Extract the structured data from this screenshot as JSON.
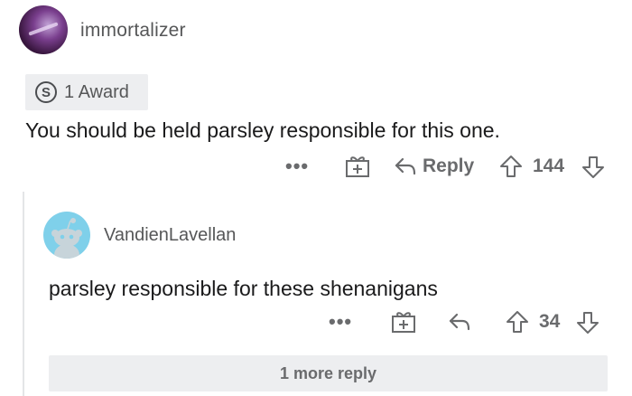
{
  "comment": {
    "author": "immortalizer",
    "award_label": "1 Award",
    "body": "You should be held parsley responsible for this one.",
    "actions": {
      "more": "•••",
      "reply": "Reply",
      "score": "144"
    }
  },
  "reply": {
    "author": "VandienLavellan",
    "body": "parsley responsible for these shenanigans",
    "actions": {
      "more": "•••",
      "score": "34"
    }
  },
  "more_replies": "1 more reply",
  "icons": {
    "award_coin": "S"
  }
}
